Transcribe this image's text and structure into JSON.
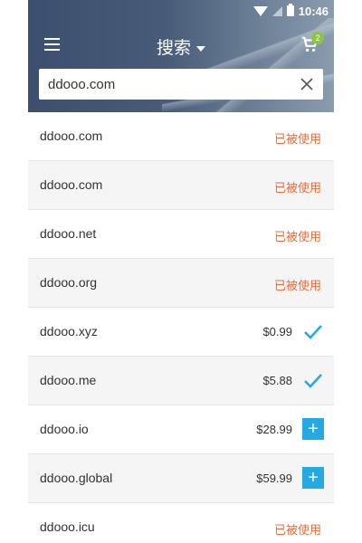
{
  "statusbar": {
    "time": "10:46"
  },
  "toolbar": {
    "title": "搜索",
    "cart_count": "2"
  },
  "search": {
    "value": "ddooo.com",
    "placeholder": ""
  },
  "results": [
    {
      "domain": "ddooo.com",
      "status": "已被使用"
    },
    {
      "domain": "ddooo.com",
      "status": "已被使用"
    },
    {
      "domain": "ddooo.net",
      "status": "已被使用"
    },
    {
      "domain": "ddooo.org",
      "status": "已被使用"
    },
    {
      "domain": "ddooo.xyz",
      "price": "$0.99",
      "action": "check"
    },
    {
      "domain": "ddooo.me",
      "price": "$5.88",
      "action": "check"
    },
    {
      "domain": "ddooo.io",
      "price": "$28.99",
      "action": "add"
    },
    {
      "domain": "ddooo.global",
      "price": "$59.99",
      "action": "add"
    },
    {
      "domain": "ddooo.icu",
      "status": "已被使用"
    }
  ],
  "colors": {
    "taken": "#f06a37",
    "accent": "#26a9e0",
    "badge": "#8cc63f"
  }
}
